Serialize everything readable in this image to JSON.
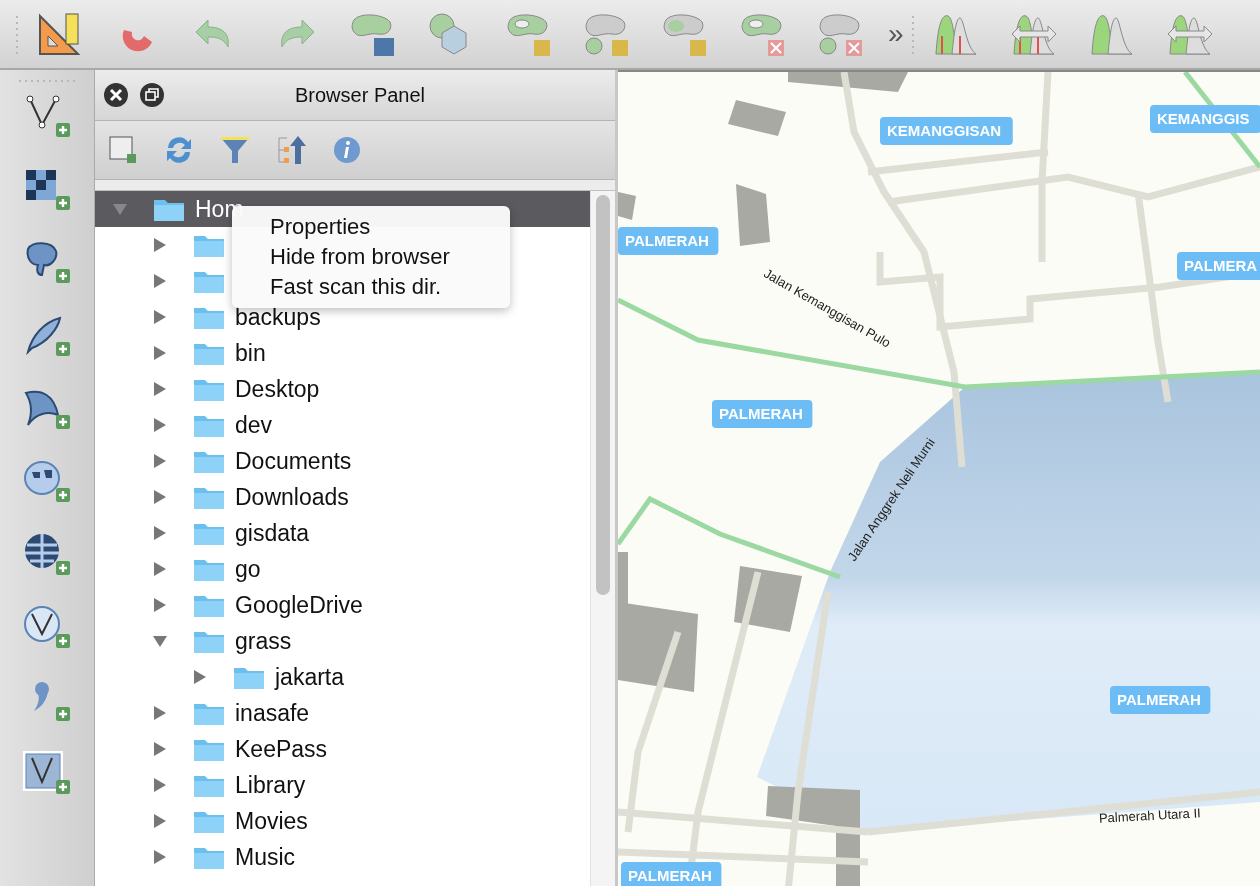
{
  "toolbar": {
    "overflow": "»"
  },
  "browser_panel": {
    "title": "Browser Panel",
    "tree": [
      {
        "label": "Hom",
        "selected": true,
        "expanded": true,
        "children": [
          {
            "selected": false,
            "expanded": false
          },
          {
            "selected": false,
            "expanded": false
          },
          {
            "label": "backups",
            "selected": false,
            "expanded": false
          },
          {
            "label": "bin",
            "selected": false,
            "expanded": false
          },
          {
            "label": "Desktop",
            "selected": false,
            "expanded": false
          },
          {
            "label": "dev",
            "selected": false,
            "expanded": false
          },
          {
            "label": "Documents",
            "selected": false,
            "expanded": false
          },
          {
            "label": "Downloads",
            "selected": false,
            "expanded": false
          },
          {
            "label": "gisdata",
            "selected": false,
            "expanded": false
          },
          {
            "label": "go",
            "selected": false,
            "expanded": false
          },
          {
            "label": "GoogleDrive",
            "selected": false,
            "expanded": false
          },
          {
            "label": "grass",
            "selected": false,
            "expanded": true,
            "children": [
              {
                "label": "jakarta",
                "selected": false,
                "expanded": false
              }
            ]
          },
          {
            "label": "inasafe",
            "selected": false,
            "expanded": false
          },
          {
            "label": "KeePass",
            "selected": false,
            "expanded": false
          },
          {
            "label": "Library",
            "selected": false,
            "expanded": false
          },
          {
            "label": "Movies",
            "selected": false,
            "expanded": false
          },
          {
            "label": "Music",
            "selected": false,
            "expanded": false
          }
        ]
      }
    ],
    "context_menu": [
      "Properties",
      "Hide from browser",
      "Fast scan this dir."
    ]
  },
  "map": {
    "place_labels": [
      {
        "text": "KEMANGGISAN"
      },
      {
        "text": "KEMANGGIS"
      },
      {
        "text": "PALMERAH"
      },
      {
        "text": "PALMERA"
      },
      {
        "text": "PALMERAH"
      },
      {
        "text": "PALMERAH"
      },
      {
        "text": "PALMERAH"
      }
    ],
    "street_labels": [
      {
        "text": "Jalan Kemanggisan Pulo"
      },
      {
        "text": "Jalan Anggrek Neli Murni"
      },
      {
        "text": "Palmerah Utara II"
      }
    ]
  }
}
